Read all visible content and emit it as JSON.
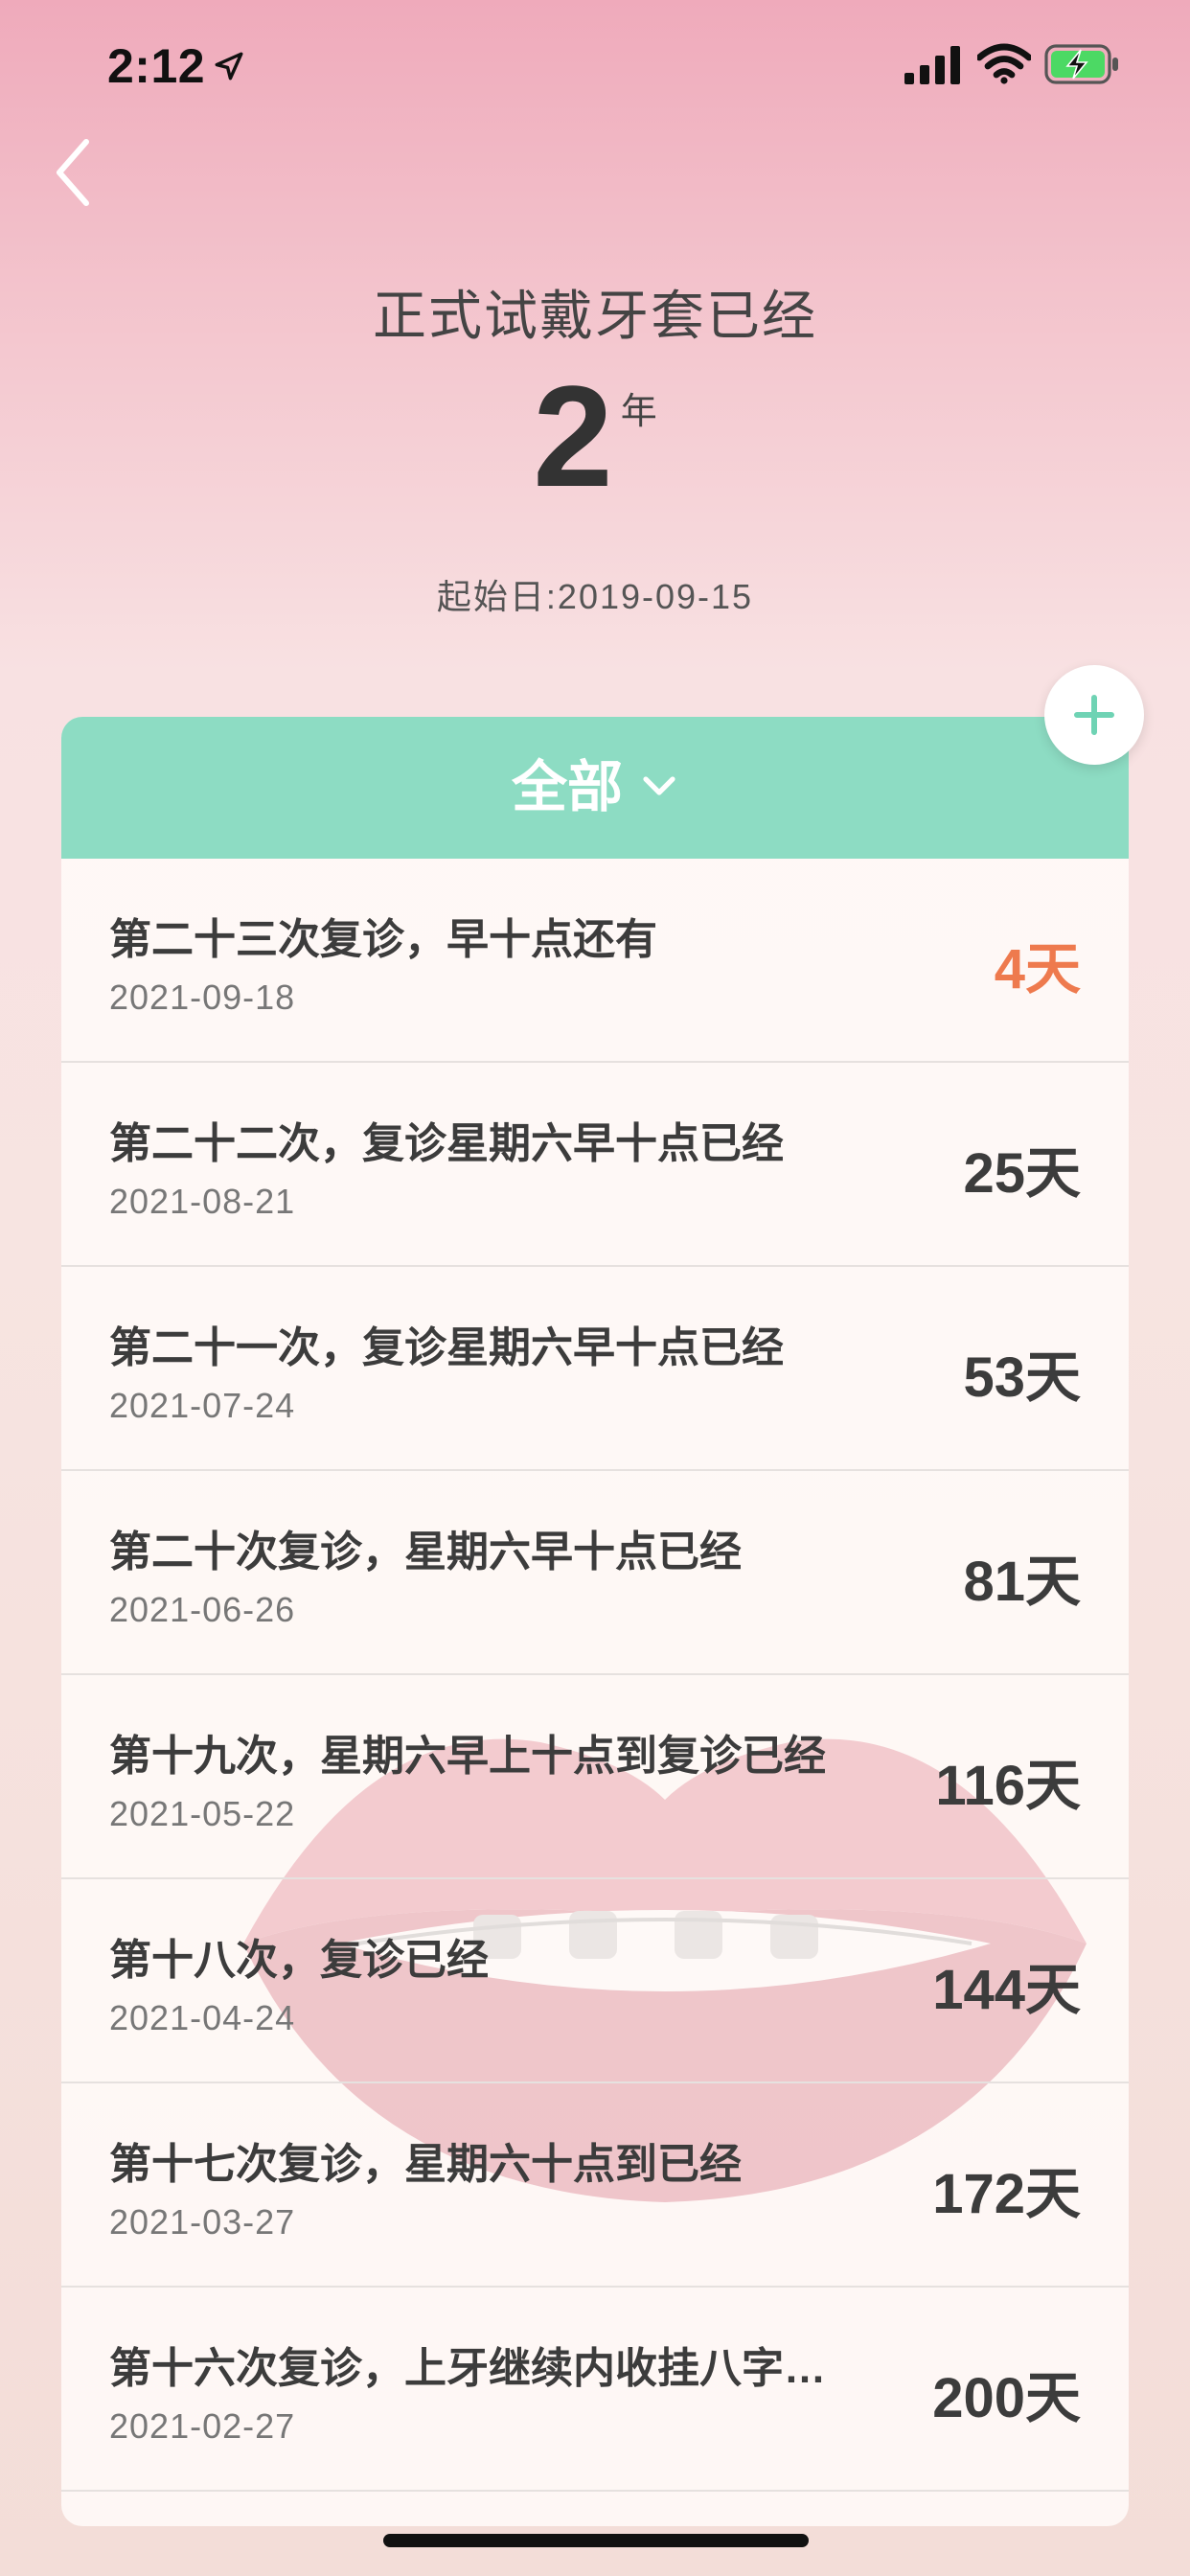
{
  "status_bar": {
    "time": "2:12",
    "icons": [
      "location-arrow-icon",
      "cellular-signal-icon",
      "wifi-icon",
      "battery-charging-icon"
    ]
  },
  "nav": {
    "back_icon": "chevron-left-icon"
  },
  "header": {
    "title": "正式试戴牙套已经",
    "count": "2",
    "unit": "年",
    "start_date": "起始日:2019-09-15"
  },
  "add_button": {
    "icon": "plus-icon",
    "color": "#6fd3b4"
  },
  "filter": {
    "label": "全部",
    "icon": "chevron-down-icon",
    "color": "#8ddcc3"
  },
  "colors": {
    "upcoming": "#ee7a4e",
    "text": "#3c3c3c"
  },
  "items": [
    {
      "title": "第二十三次复诊，早十点还有",
      "date": "2021-09-18",
      "days": "4天"
    },
    {
      "title": "第二十二次，复诊星期六早十点已经",
      "date": "2021-08-21",
      "days": "25天"
    },
    {
      "title": "第二十一次，复诊星期六早十点已经",
      "date": "2021-07-24",
      "days": "53天"
    },
    {
      "title": "第二十次复诊，星期六早十点已经",
      "date": "2021-06-26",
      "days": "81天"
    },
    {
      "title": "第十九次，星期六早上十点到复诊已经",
      "date": "2021-05-22",
      "days": "116天"
    },
    {
      "title": "第十八次，复诊已经",
      "date": "2021-04-24",
      "days": "144天"
    },
    {
      "title": "第十七次复诊，星期六十点到已经",
      "date": "2021-03-27",
      "days": "172天"
    },
    {
      "title": "第十六次复诊，上牙继续内收挂八字…",
      "date": "2021-02-27",
      "days": "200天"
    }
  ]
}
